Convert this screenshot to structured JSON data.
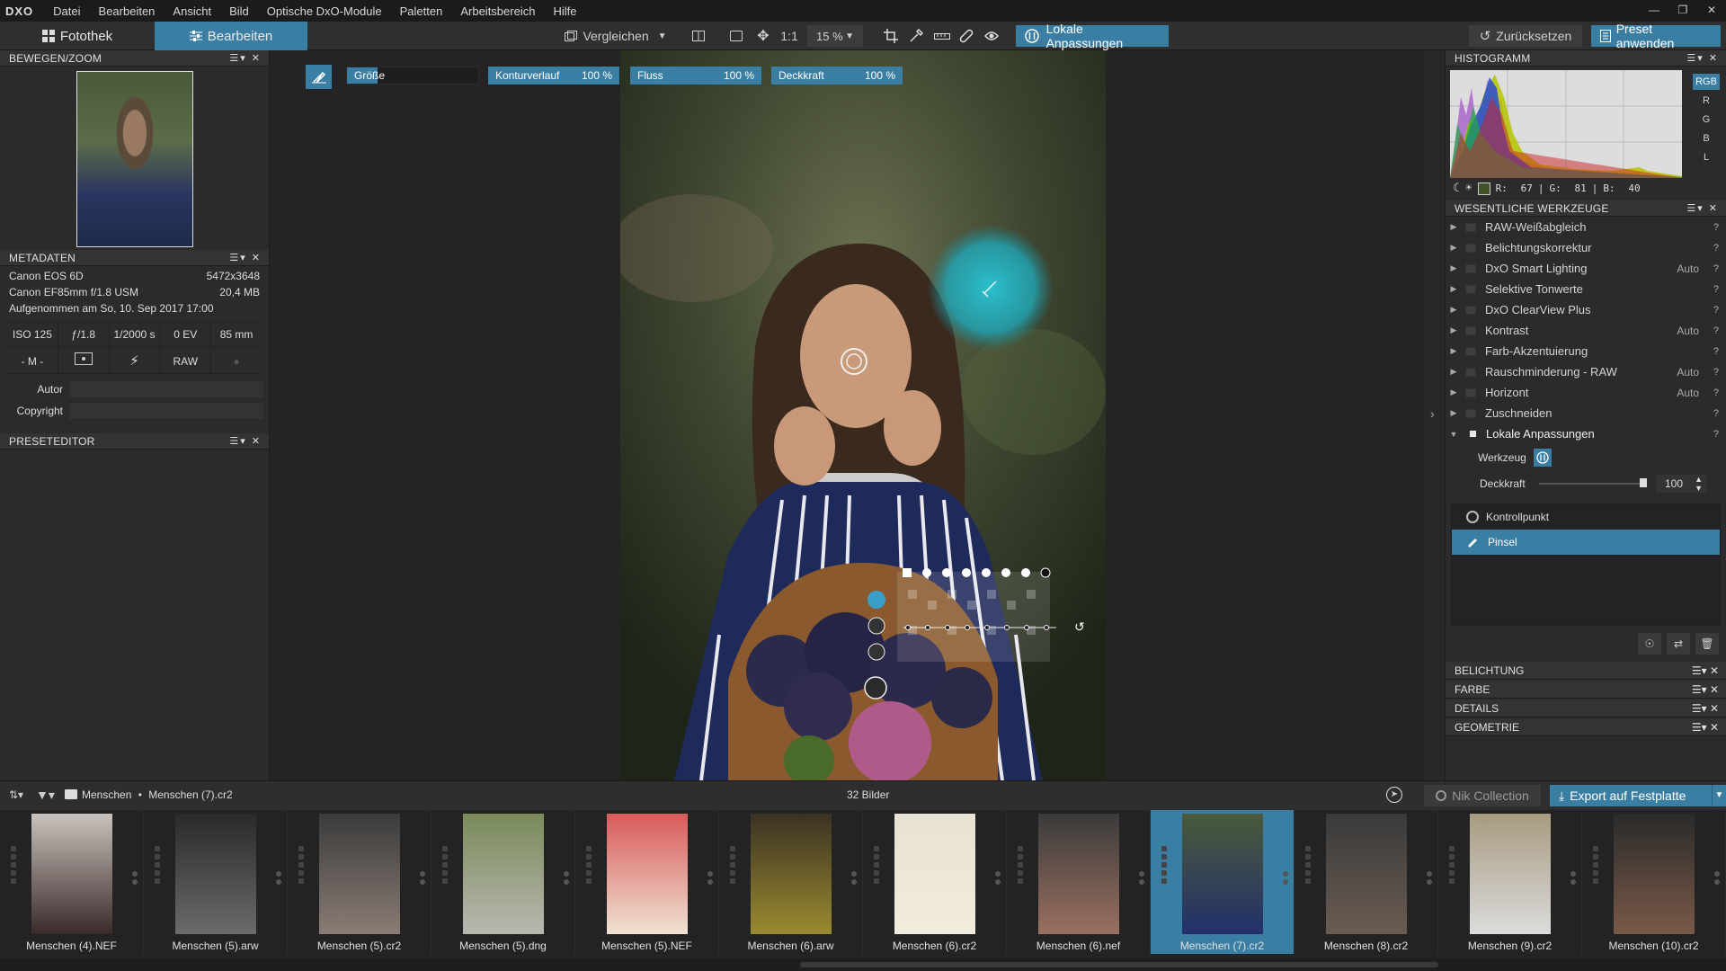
{
  "app": {
    "logo": "DXO"
  },
  "menu": [
    "Datei",
    "Bearbeiten",
    "Ansicht",
    "Bild",
    "Optische DxO-Module",
    "Paletten",
    "Arbeitsbereich",
    "Hilfe"
  ],
  "tabs": {
    "photo_library": "Fotothek",
    "edit": "Bearbeiten"
  },
  "toolbar": {
    "compare": "Vergleichen",
    "one_to_one": "1:1",
    "zoom": "15 %",
    "local_adjust": "Lokale Anpassungen",
    "reset": "Zurücksetzen",
    "apply_preset": "Preset anwenden"
  },
  "left": {
    "move_zoom": {
      "title": "BEWEGEN/ZOOM"
    },
    "metadata": {
      "title": "METADATEN",
      "camera": "Canon EOS 6D",
      "resolution": "5472x3648",
      "lens": "Canon EF85mm f/1.8 USM",
      "filesize": "20,4 MB",
      "taken": "Aufgenommen am So, 10. Sep 2017 17:00",
      "exif": [
        "ISO 125",
        "ƒ/1.8",
        "1/2000 s",
        "0 EV",
        "85 mm"
      ],
      "mode": "- M -",
      "format": "RAW",
      "author_label": "Autor",
      "copyright_label": "Copyright"
    },
    "preset_editor": {
      "title": "PRESETEDITOR"
    }
  },
  "brush": {
    "size": "Größe",
    "feather": "Konturverlauf",
    "feather_val": "100 %",
    "flow": "Fluss",
    "flow_val": "100 %",
    "opacity": "Deckkraft",
    "opacity_val": "100 %"
  },
  "right": {
    "histogram": {
      "title": "HISTOGRAMM",
      "channels": [
        "RGB",
        "R",
        "G",
        "B",
        "L"
      ],
      "r_label": "R:",
      "r": "67",
      "g_label": "G:",
      "g": "81",
      "b_label": "B:",
      "b": "40"
    },
    "essential": {
      "title": "WESENTLICHE WERKZEUGE",
      "tools": [
        {
          "name": "RAW-Weißabgleich",
          "auto": ""
        },
        {
          "name": "Belichtungskorrektur",
          "auto": ""
        },
        {
          "name": "DxO Smart Lighting",
          "auto": "Auto"
        },
        {
          "name": "Selektive Tonwerte",
          "auto": ""
        },
        {
          "name": "DxO ClearView Plus",
          "auto": ""
        },
        {
          "name": "Kontrast",
          "auto": "Auto"
        },
        {
          "name": "Farb-Akzentuierung",
          "auto": ""
        },
        {
          "name": "Rauschminderung - RAW",
          "auto": "Auto"
        },
        {
          "name": "Horizont",
          "auto": "Auto"
        },
        {
          "name": "Zuschneiden",
          "auto": ""
        }
      ],
      "help": "?",
      "local": {
        "name": "Lokale Anpassungen",
        "tool_label": "Werkzeug",
        "opacity_label": "Deckkraft",
        "opacity_value": "100",
        "opacity_fraction": 1.0
      },
      "masks": [
        "Kontrollpunkt",
        "Pinsel"
      ]
    },
    "sections": [
      "BELICHTUNG",
      "FARBE",
      "DETAILS",
      "GEOMETRIE"
    ]
  },
  "stripbar": {
    "folder": "Menschen",
    "sep": "•",
    "file": "Menschen (7).cr2",
    "count": "32 Bilder",
    "nik": "Nik Collection",
    "export": "Export auf Festplatte"
  },
  "thumbs": [
    {
      "name": "Menschen (4).NEF",
      "c1": "#c9c2bc",
      "c2": "#3a2a2a"
    },
    {
      "name": "Menschen (5).arw",
      "c1": "#2a2a2a",
      "c2": "#6a6a6a"
    },
    {
      "name": "Menschen (5).cr2",
      "c1": "#3b3b3b",
      "c2": "#8a7c74"
    },
    {
      "name": "Menschen (5).dng",
      "c1": "#7a8a5a",
      "c2": "#b8b8b0"
    },
    {
      "name": "Menschen (5).NEF",
      "c1": "#d85a5a",
      "c2": "#f0e2d2"
    },
    {
      "name": "Menschen (6).arw",
      "c1": "#3a3222",
      "c2": "#9a8a32"
    },
    {
      "name": "Menschen (6).cr2",
      "c1": "#e8e2d2",
      "c2": "#f2ecdc"
    },
    {
      "name": "Menschen (6).nef",
      "c1": "#3a3a3a",
      "c2": "#9a7060"
    },
    {
      "name": "Menschen (7).cr2",
      "c1": "#4a5a3a",
      "c2": "#22306a",
      "selected": true
    },
    {
      "name": "Menschen (8).cr2",
      "c1": "#3a3a3a",
      "c2": "#6a5c52"
    },
    {
      "name": "Menschen (9).cr2",
      "c1": "#a89a80",
      "c2": "#dcdcdc"
    },
    {
      "name": "Menschen (10).cr2",
      "c1": "#2a2a2a",
      "c2": "#7a5a48"
    }
  ],
  "colors": {
    "accent": "#3a7fa3",
    "panel": "#2b2b2b",
    "mask_cyan": "#29b3c8"
  }
}
